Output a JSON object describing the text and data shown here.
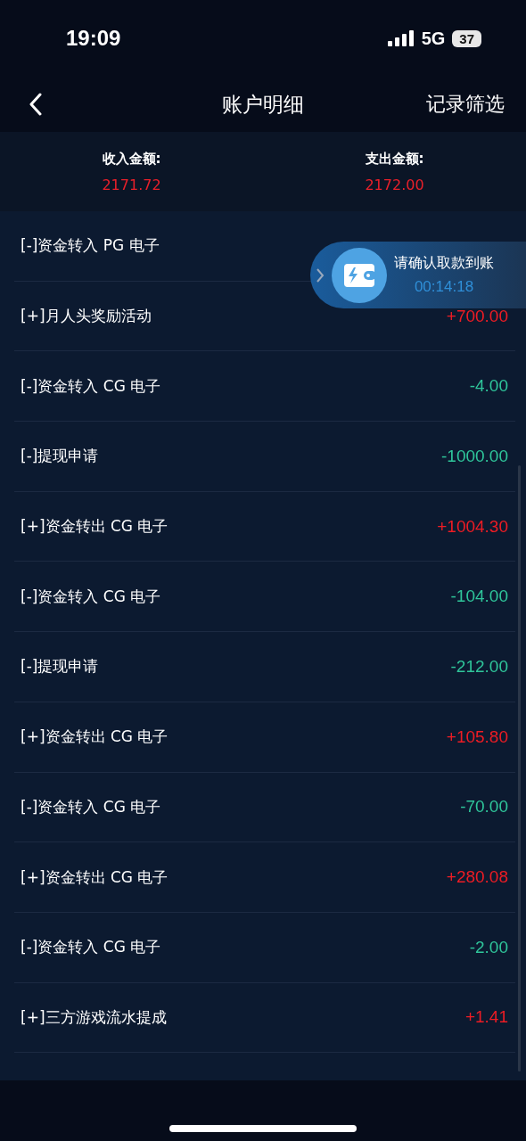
{
  "status_bar": {
    "time": "19:09",
    "network": "5G",
    "battery": "37"
  },
  "nav": {
    "title": "账户明细",
    "action": "记录筛选"
  },
  "summary": [
    {
      "label": "收入金额:",
      "value": "2171.72"
    },
    {
      "label": "支出金额:",
      "value": "2172.00"
    }
  ],
  "records": [
    {
      "label": "[-]资金转入 PG 电子"
    },
    {
      "label": "[+]月人头奖励活动",
      "amount": "+700.00",
      "kind": "income"
    },
    {
      "label": "[-]资金转入 CG 电子",
      "amount": "-4.00",
      "kind": "expense"
    },
    {
      "label": "[-]提现申请",
      "amount": "-1000.00",
      "kind": "expense"
    },
    {
      "label": "[+]资金转出 CG 电子",
      "amount": "+1004.30",
      "kind": "income"
    },
    {
      "label": "[-]资金转入 CG 电子",
      "amount": "-104.00",
      "kind": "expense"
    },
    {
      "label": "[-]提现申请",
      "amount": "-212.00",
      "kind": "expense"
    },
    {
      "label": "[+]资金转出 CG 电子",
      "amount": "+105.80",
      "kind": "income"
    },
    {
      "label": "[-]资金转入 CG 电子",
      "amount": "-70.00",
      "kind": "expense"
    },
    {
      "label": "[+]资金转出 CG 电子",
      "amount": "+280.08",
      "kind": "income"
    },
    {
      "label": "[-]资金转入 CG 电子",
      "amount": "-2.00",
      "kind": "expense"
    },
    {
      "label": "[+]三方游戏流水提成",
      "amount": "+1.41",
      "kind": "income"
    }
  ],
  "floating_banner": {
    "message": "请确认取款到账",
    "timer": "00:14:18"
  }
}
